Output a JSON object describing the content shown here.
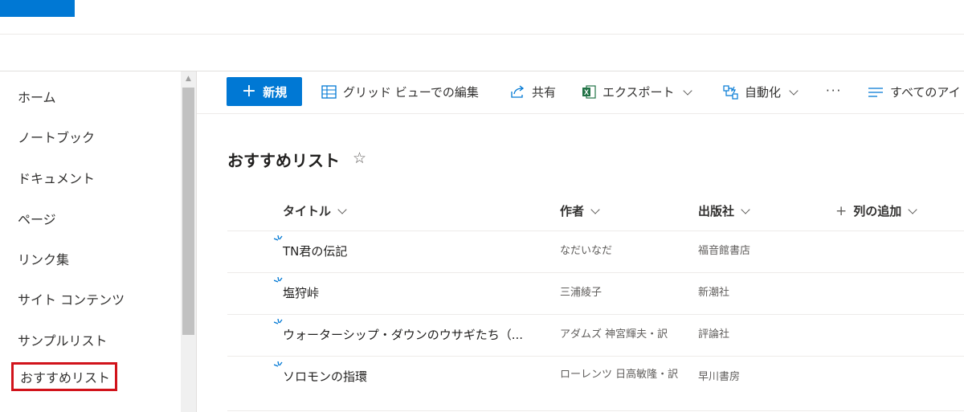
{
  "colors": {
    "accent": "#0078d4",
    "highlight_border": "#d1131b",
    "excel_green": "#217346"
  },
  "sidebar": {
    "items": [
      {
        "label": "ホーム"
      },
      {
        "label": "ノートブック"
      },
      {
        "label": "ドキュメント"
      },
      {
        "label": "ページ"
      },
      {
        "label": "リンク集"
      },
      {
        "label": "サイト コンテンツ"
      },
      {
        "label": "サンプルリスト"
      },
      {
        "label": "おすすめリスト",
        "selected": true
      }
    ]
  },
  "toolbar": {
    "new_label": "新規",
    "grid_edit_label": "グリッド ビューでの編集",
    "share_label": "共有",
    "export_label": "エクスポート",
    "automate_label": "自動化",
    "more_label": "···",
    "view_label": "すべてのアイ",
    "icons": [
      "plus-icon",
      "grid-icon",
      "share-icon",
      "excel-icon",
      "automate-icon",
      "more-icon",
      "view-lines-icon"
    ]
  },
  "list": {
    "title": "おすすめリスト",
    "favorite_icon": "star-icon",
    "columns": {
      "title": "タイトル",
      "author": "作者",
      "publisher": "出版社",
      "add": "列の追加"
    },
    "rows": [
      {
        "title": "TN君の伝記",
        "author": "なだいなだ",
        "publisher": "福音館書店"
      },
      {
        "title": "塩狩峠",
        "author": "三浦綾子",
        "publisher": "新潮社"
      },
      {
        "title": "ウォーターシップ・ダウンのウサギたち（...",
        "author": "アダムズ 神宮輝夫・訳",
        "publisher": "評論社"
      },
      {
        "title": "ソロモンの指環",
        "author": "ローレンツ 日高敏隆・訳",
        "publisher": "早川書房"
      }
    ]
  }
}
